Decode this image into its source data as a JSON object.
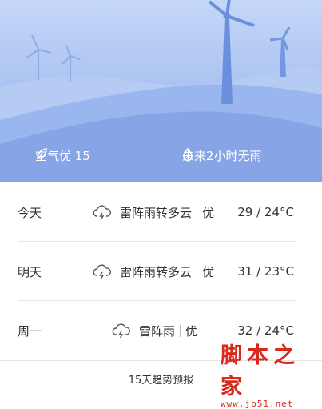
{
  "summary": {
    "air_quality_label": "空气优 15",
    "rain_forecast_label": "未来2小时无雨"
  },
  "forecast": [
    {
      "day": "今天",
      "condition": "雷阵雨转多云",
      "aqi": "优",
      "temp": "29 / 24°C",
      "icon": "thunder-cloud-icon"
    },
    {
      "day": "明天",
      "condition": "雷阵雨转多云",
      "aqi": "优",
      "temp": "31 / 23°C",
      "icon": "thunder-cloud-icon"
    },
    {
      "day": "周一",
      "condition": "雷阵雨",
      "aqi": "优",
      "temp": "32 / 24°C",
      "icon": "thunder-cloud-icon"
    }
  ],
  "footer": {
    "link_label": "15天趋势预报"
  },
  "watermark": {
    "title": "脚本之家",
    "url": "www.jb51.net"
  },
  "colors": {
    "hero_top": "#c4d7f7",
    "hero_bottom": "#8fadea",
    "watermark": "#d9291c"
  }
}
